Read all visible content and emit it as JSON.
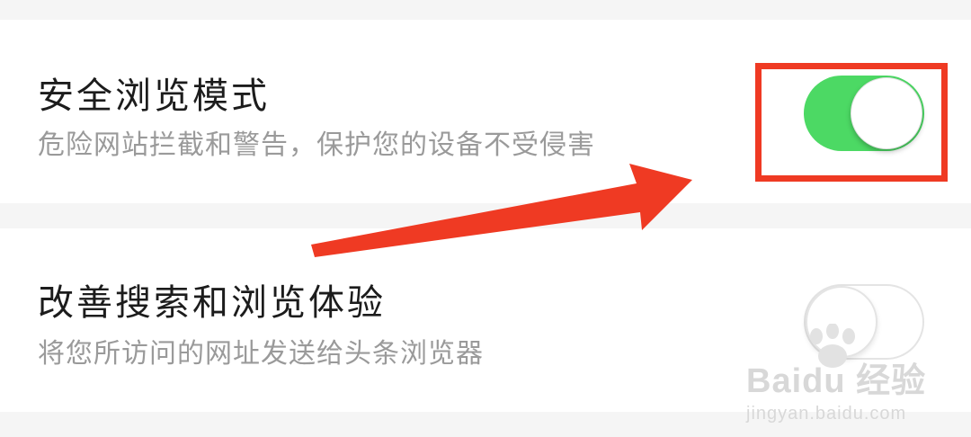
{
  "settings": {
    "items": [
      {
        "title": "安全浏览模式",
        "description": "危险网站拦截和警告，保护您的设备不受侵害",
        "enabled": true
      },
      {
        "title": "改善搜索和浏览体验",
        "description": "将您所访问的网址发送给头条浏览器",
        "enabled": false
      }
    ]
  },
  "annotation": {
    "highlight_color": "#ef3a23"
  },
  "colors": {
    "toggle_on": "#4cd964",
    "background": "#f5f5f5",
    "card": "#ffffff"
  },
  "watermark": {
    "brand": "Baidu 经验",
    "url": "jingyan.baidu.com"
  }
}
